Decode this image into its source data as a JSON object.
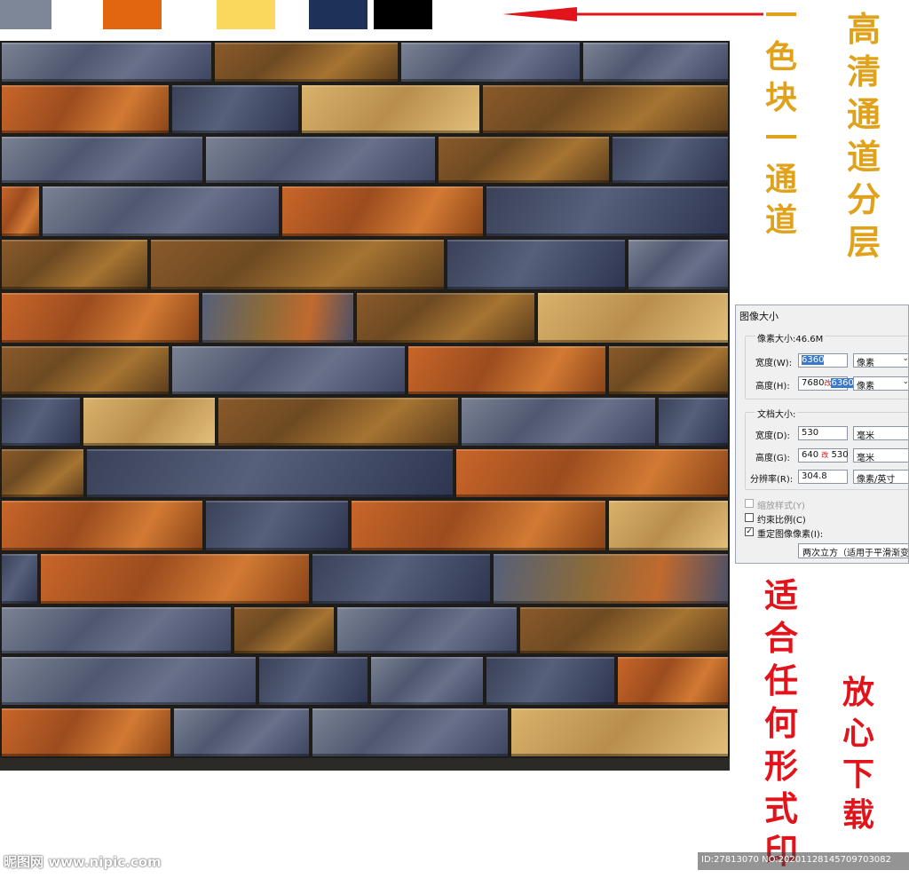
{
  "swatches": [
    {
      "name": "swatch-gray",
      "color": "#7d8797"
    },
    {
      "name": "swatch-white",
      "color": "#ffffff"
    },
    {
      "name": "swatch-orange",
      "color": "#e2650f"
    },
    {
      "name": "swatch-white-2",
      "color": "#ffffff"
    },
    {
      "name": "swatch-yellow",
      "color": "#fad85c"
    },
    {
      "name": "swatch-navy",
      "color": "#1e3159"
    },
    {
      "name": "swatch-black",
      "color": "#000000"
    }
  ],
  "annotations": {
    "color_channel": "一色块一通道",
    "hd_layers": "高清通道分层",
    "any_print": "适合任何形式印",
    "download": "放心下载",
    "gold_color": "#e0a21a",
    "red_color": "#e2131a"
  },
  "dialog": {
    "title": "图像大小",
    "pixel_size": "像素大小:46.6M",
    "width_label": "宽度(W):",
    "width_value": "6360",
    "width_unit": "像素",
    "height_label": "高度(H):",
    "height_old": "7680",
    "height_mark": "改",
    "height_value": "6360",
    "height_unit": "像素",
    "doc_size": "文档大小:",
    "doc_width_label": "宽度(D):",
    "doc_width_value": "530",
    "doc_width_unit": "毫米",
    "doc_height_label": "高度(G):",
    "doc_height_old": "640",
    "doc_height_mark": "改",
    "doc_height_new": "530",
    "doc_height_unit": "毫米",
    "resolution_label": "分辨率(R):",
    "resolution_value": "304.8",
    "resolution_unit": "像素/英寸",
    "scale_styles": "缩放样式(Y)",
    "constrain": "约束比例(C)",
    "resample": "重定图像像素(I):",
    "resample_method": "两次立方（适用于平滑渐变"
  },
  "footer": {
    "watermark": "昵图网 www.nipic.com",
    "id_text": "ID:27813070 NO:20201128145709703082"
  }
}
